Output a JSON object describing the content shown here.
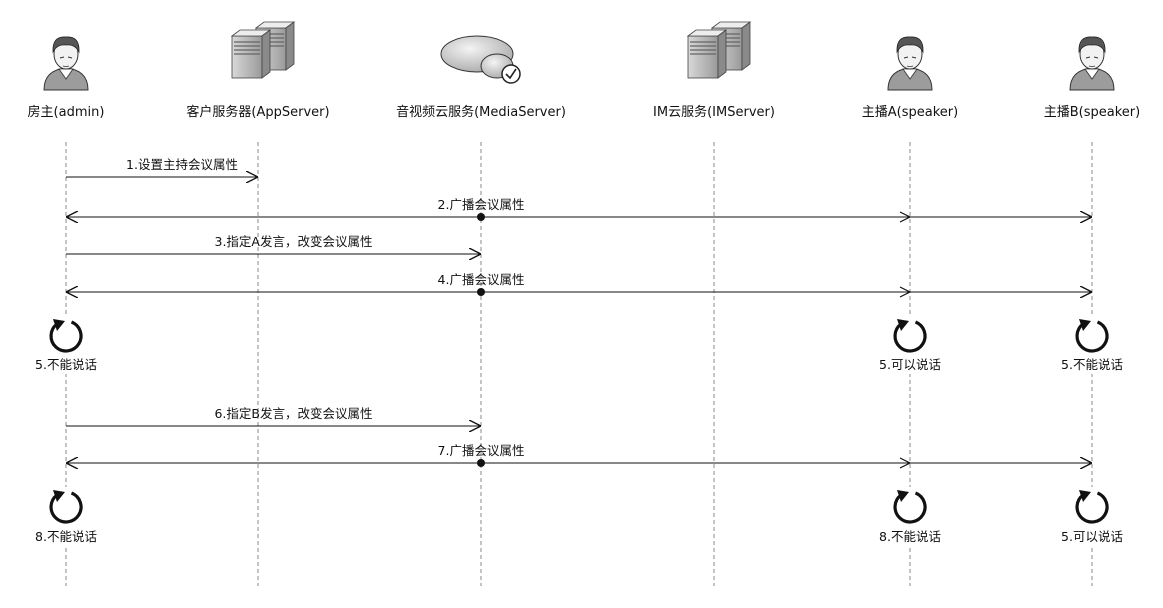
{
  "participants": [
    {
      "id": "admin",
      "label": "房主(admin)",
      "icon": "user-icon"
    },
    {
      "id": "app",
      "label": "客户服务器(AppServer)",
      "icon": "server-icon"
    },
    {
      "id": "media",
      "label": "音视频云服务(MediaServer)",
      "icon": "cloud-icon"
    },
    {
      "id": "im",
      "label": "IM云服务(IMServer)",
      "icon": "server-icon"
    },
    {
      "id": "speakerA",
      "label": "主播A(speaker)",
      "icon": "user-icon"
    },
    {
      "id": "speakerB",
      "label": "主播B(speaker)",
      "icon": "user-icon"
    }
  ],
  "messages": [
    {
      "label": "1.设置主持会议属性",
      "from": "admin",
      "to": [
        "app"
      ],
      "kind": "send"
    },
    {
      "label": "2.广播会议属性",
      "from": "media",
      "to": [
        "admin",
        "speakerA",
        "speakerB"
      ],
      "kind": "broadcast"
    },
    {
      "label": "3.指定A发言，改变会议属性",
      "from": "admin",
      "to": [
        "media"
      ],
      "kind": "send"
    },
    {
      "label": "4.广播会议属性",
      "from": "media",
      "to": [
        "admin",
        "speakerA",
        "speakerB"
      ],
      "kind": "broadcast"
    },
    {
      "label": "6.指定B发言，改变会议属性",
      "from": "admin",
      "to": [
        "media"
      ],
      "kind": "send"
    },
    {
      "label": "7.广播会议属性",
      "from": "media",
      "to": [
        "admin",
        "speakerA",
        "speakerB"
      ],
      "kind": "broadcast"
    }
  ],
  "states": [
    {
      "participant": "admin",
      "label": "5.不能说话"
    },
    {
      "participant": "speakerA",
      "label": "5.可以说话"
    },
    {
      "participant": "speakerB",
      "label": "5.不能说话"
    },
    {
      "participant": "admin",
      "label": "8.不能说话"
    },
    {
      "participant": "speakerA",
      "label": "8.不能说话"
    },
    {
      "participant": "speakerB",
      "label": "5.可以说话"
    }
  ]
}
